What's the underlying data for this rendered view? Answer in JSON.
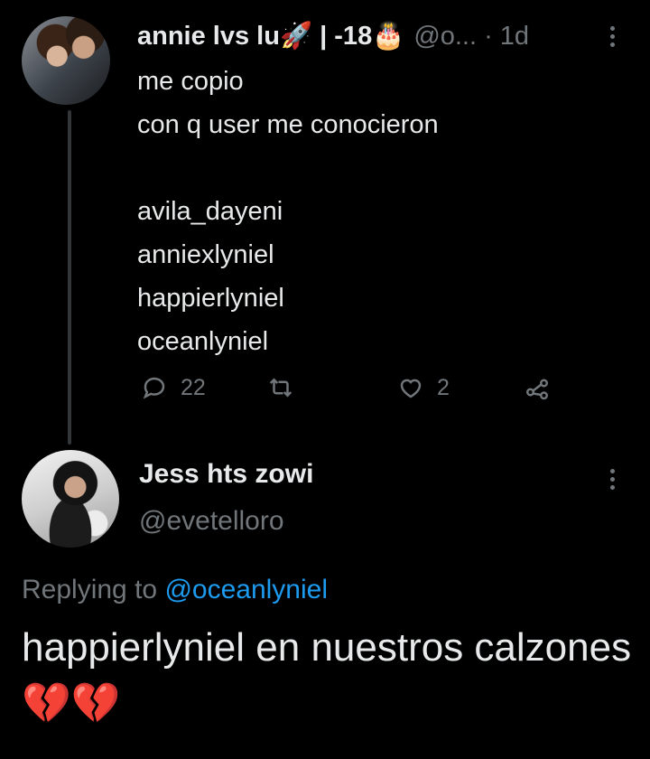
{
  "tweet1": {
    "display_name": "annie lvs lu🚀 | -18🎂",
    "handle": "@o...",
    "separator": "·",
    "time": "1d",
    "lines": [
      "me copio",
      "con q user me conocieron",
      "",
      "avila_dayeni",
      "anniexlyniel",
      "happierlyniel",
      "oceanlyniel"
    ],
    "actions": {
      "replies": "22",
      "retweets": "",
      "likes": "2"
    }
  },
  "tweet2": {
    "display_name": "Jess hts zowi",
    "handle": "@evetelloro",
    "replying_prefix": "Replying to ",
    "replying_mention": "@oceanlyniel",
    "text": "happierlyniel en nuestros calzones💔💔"
  },
  "colors": {
    "background": "#000000",
    "text": "#e7e9ea",
    "muted": "#71767b",
    "link": "#1d9bf0",
    "heart_red": "#e0245e"
  },
  "icons": [
    "reply-icon",
    "retweet-icon",
    "like-icon",
    "share-icon",
    "more-icon",
    "broken-heart-emoji"
  ]
}
